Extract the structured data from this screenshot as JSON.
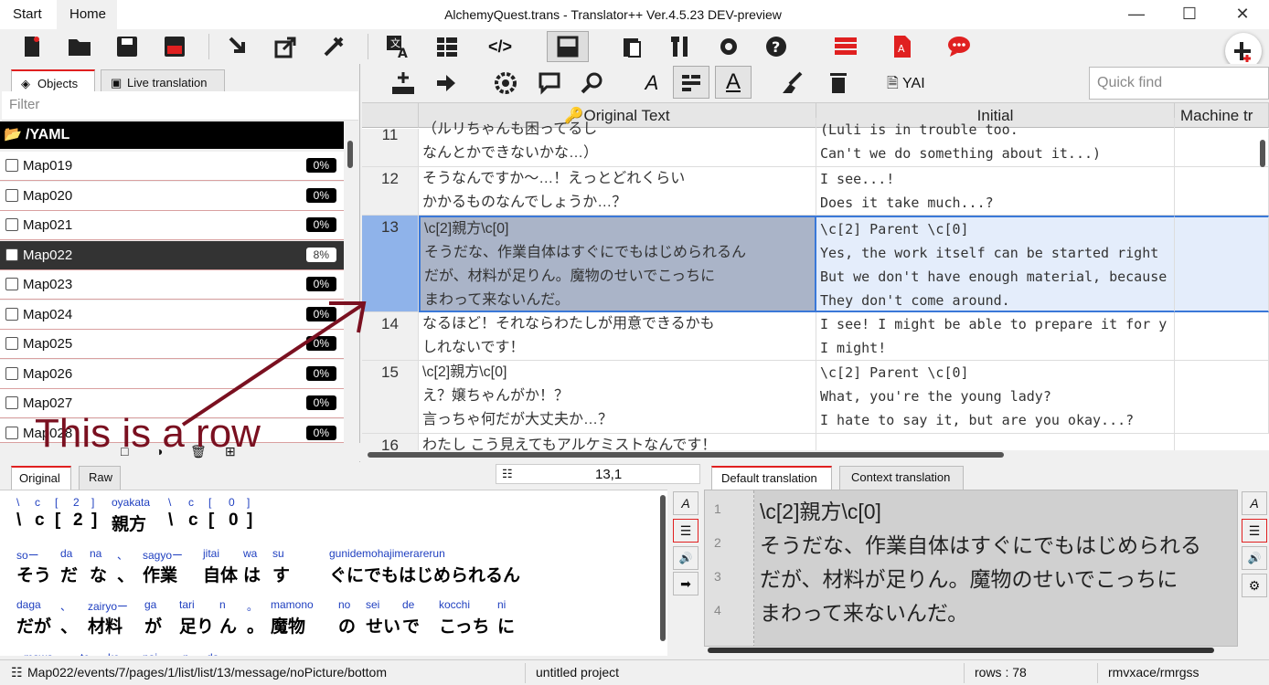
{
  "titlebar": {
    "tabs": [
      "Start",
      "Home"
    ],
    "title": "AlchemyQuest.trans - Translator++ Ver.4.5.23 DEV-preview"
  },
  "toolbar2": {
    "yaml_label": "YAI",
    "quickfind_placeholder": "Quick find"
  },
  "left": {
    "tabs": [
      "Objects",
      "Live translation"
    ],
    "filter_placeholder": "Filter",
    "folder": "/YAML",
    "maps": [
      {
        "name": "Map019",
        "pct": "0%"
      },
      {
        "name": "Map020",
        "pct": "0%"
      },
      {
        "name": "Map021",
        "pct": "0%"
      },
      {
        "name": "Map022",
        "pct": "8%"
      },
      {
        "name": "Map023",
        "pct": "0%"
      },
      {
        "name": "Map024",
        "pct": "0%"
      },
      {
        "name": "Map025",
        "pct": "0%"
      },
      {
        "name": "Map026",
        "pct": "0%"
      },
      {
        "name": "Map027",
        "pct": "0%"
      },
      {
        "name": "Map028",
        "pct": "0%"
      }
    ]
  },
  "annotation": "This is a row",
  "grid": {
    "headers": [
      "Original Text",
      "Initial",
      "Machine tr"
    ],
    "rows": [
      {
        "num": "11",
        "orig": "（ルリちゃんも困ってるし\nなんとかできないかな…）",
        "init": "(Luli is in trouble too.\nCan't we do something about it...)"
      },
      {
        "num": "12",
        "orig": "そうなんですか～…！えっとどれくらい\nかかるものなんでしょうか…？",
        "init": "I see...!\nDoes it take much...?"
      },
      {
        "num": "13",
        "orig": "\\c[2]親方\\c[0]\nそうだな、作業自体はすぐにでもはじめられるん\nだが、材料が足りん。魔物のせいでこっちに\nまわって来ないんだ。",
        "init": "\\c[2] Parent \\c[0]\nYes, the work itself can be started right\nBut we don't have enough material, because\nThey don't come around."
      },
      {
        "num": "14",
        "orig": "なるほど！それならわたしが用意できるかも\nしれないです！",
        "init": "I see! I might be able to prepare it for y\nI might!"
      },
      {
        "num": "15",
        "orig": "\\c[2]親方\\c[0]\nえ？嬢ちゃんがか！？\n言っちゃ何だが大丈夫か…？",
        "init": "\\c[2] Parent \\c[0]\nWhat, you're the young lady?\nI hate to say it, but are you okay...?"
      },
      {
        "num": "16",
        "orig": "わたし こう見えてもアルケミストなんです！",
        "init": ""
      }
    ]
  },
  "bottom_left": {
    "tabs": [
      "Original",
      "Raw"
    ],
    "cell_ref": "13,1",
    "line1": {
      "ruby": [
        "\\",
        "c",
        "[",
        "2",
        "]",
        "oyakata",
        "\\",
        "c",
        "[",
        "0",
        "]"
      ],
      "base": [
        "\\",
        "c",
        "[",
        "2",
        "]",
        "親方",
        "\\",
        "c",
        "[",
        "0",
        "]"
      ]
    },
    "line2": {
      "ruby": [
        "soー",
        "da",
        "na",
        "、",
        "sagyoー",
        "jitai",
        "wa",
        "su",
        "gunidemohajimerarerun"
      ],
      "base": [
        "そう",
        "だ",
        "な",
        "、",
        "作業",
        "自体",
        "は",
        "す",
        "ぐにでもはじめられるん"
      ]
    },
    "line3": {
      "ruby": [
        "daga",
        "、",
        "zairyoー",
        "ga",
        "tari",
        "n",
        "。",
        "mamono",
        "no",
        "sei",
        "de",
        "kocchi",
        "ni"
      ],
      "base": [
        "だが",
        "、",
        "材料",
        "が",
        "足り",
        "ん",
        "。",
        "魔物",
        "の",
        "せい",
        "で",
        "こっち",
        "に"
      ]
    },
    "line4": {
      "ruby": [
        "mawa",
        "te",
        "ko",
        "nai",
        "n",
        "da"
      ]
    }
  },
  "bottom_right": {
    "tabs": [
      "Default translation",
      "Context translation"
    ],
    "lines": [
      {
        "n": "1",
        "text": "\\c[2]親方\\c[0]"
      },
      {
        "n": "2",
        "text": "そうだな、作業自体はすぐにでもはじめられる"
      },
      {
        "n": "3",
        "text": "だが、材料が足りん。魔物のせいでこっちに"
      },
      {
        "n": "4",
        "text": "まわって来ないんだ。"
      }
    ]
  },
  "status": {
    "path": "Map022/events/7/pages/1/list/list/13/message/noPicture/bottom",
    "project": "untitled project",
    "rows": "rows : 78",
    "engine": "rmvxace/rmrgss"
  },
  "colors": {
    "accent": "#e02020",
    "selection": "#8fb3ea",
    "annotation": "#7a1020"
  }
}
